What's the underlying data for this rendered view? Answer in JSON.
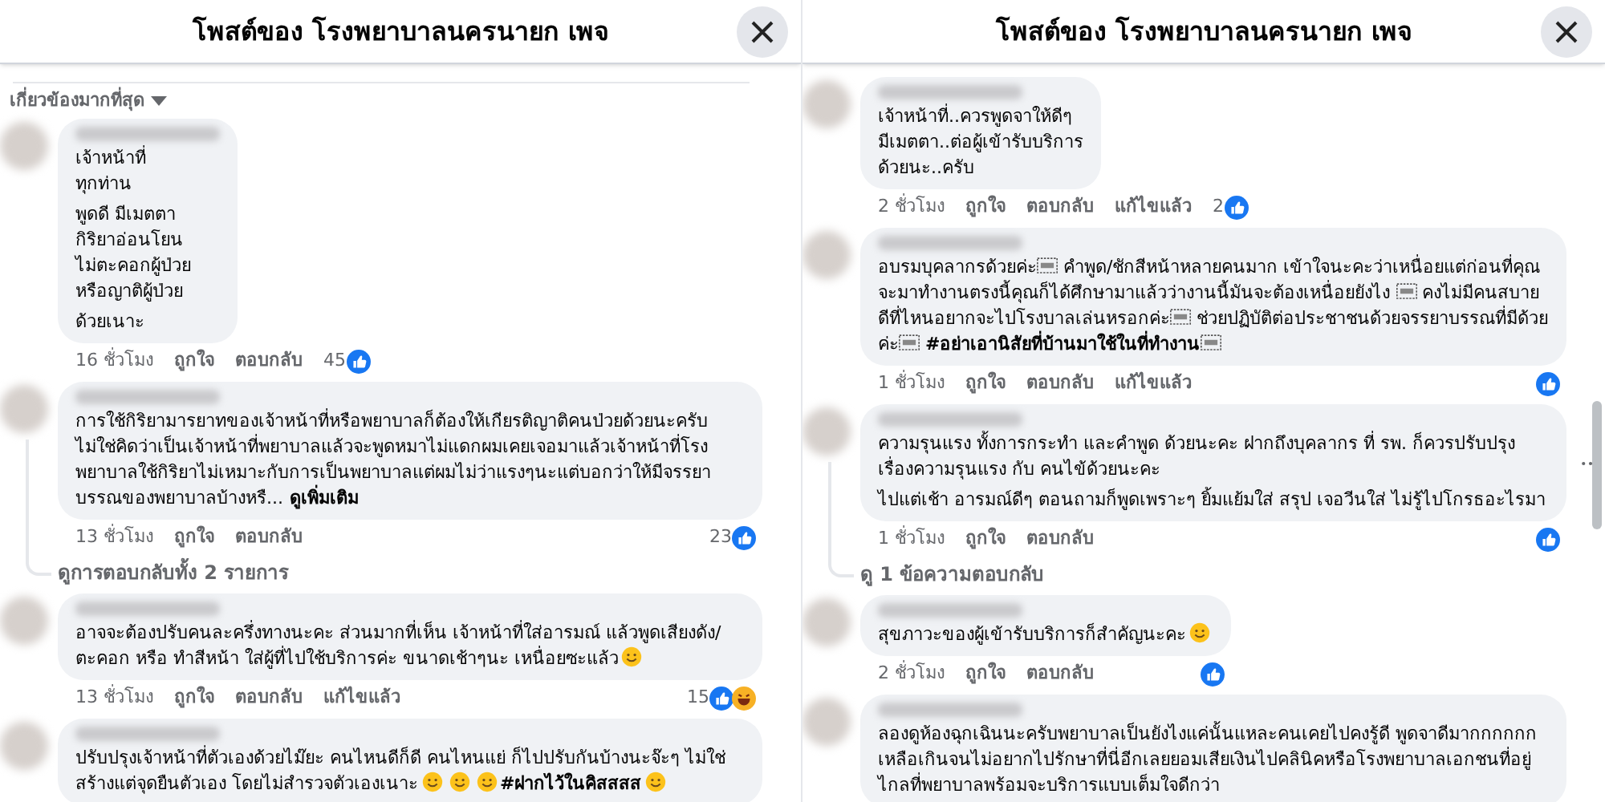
{
  "panels": [
    {
      "title": "โพสต์ของ โรงพยาบาลนครนายก เพจ",
      "sort_label": "เกี่ยวข้องมากที่สุด",
      "items": [
        {
          "kind": "comment",
          "paragraphs": [
            [
              {
                "kind": "text",
                "text": "เจ้าหน้าที่\nทุกท่าน"
              }
            ],
            [
              {
                "kind": "text",
                "text": "พูดดี มีเมตตา\nกิริยาอ่อนโยน\nไม่ตะคอกผู้ป่วย\nหรือญาติผู้ป่วย"
              }
            ],
            [
              {
                "kind": "text",
                "text": "ด้วยเนาะ"
              }
            ]
          ],
          "footer": {
            "time": "16 ชั่วโมง",
            "actions": [
              "ถูกใจ",
              "ตอบกลับ"
            ],
            "reactions": {
              "count": "45",
              "types": [
                {
                  "kind": "like"
                }
              ]
            }
          }
        },
        {
          "kind": "comment",
          "paragraphs": [
            [
              {
                "kind": "text",
                "text": "การใช้กิริยามารยาทของเจ้าหน้าที่หรือพยาบาลก็ต้องให้เกียรติญาติคนป่วยด้วยนะครับไม่ใช่คิดว่าเป็นเจ้าหน้าที่พยาบาลแล้วจะพูดหมาไม่แดกผมเคยเจอมาแล้วเจ้าหน้าที่โรงพยาบาลใช้กิริยาไม่เหมาะกับการเป็นพยาบาลแต่ผมไม่ว่าแรงๆนะแต่บอกว่าให้มีจรรยาบรรณของพยาบาลบ้างหรื..."
              },
              {
                "kind": "link",
                "text": "ดูเพิ่มเติม"
              }
            ]
          ],
          "footer": {
            "time": "13 ชั่วโมง",
            "actions": [
              "ถูกใจ",
              "ตอบกลับ"
            ],
            "reactions": {
              "count": "23",
              "types": [
                {
                  "kind": "like"
                }
              ]
            }
          }
        },
        {
          "kind": "replies",
          "text": "ดูการตอบกลับทั้ง 2 รายการ"
        },
        {
          "kind": "comment",
          "paragraphs": [
            [
              {
                "kind": "text",
                "text": "อาจจะต้องปรับคนละครึ่งทางนะคะ ส่วนมากที่เห็น เจ้าหน้าที่ใส่อารมณ์ แล้วพูดเสียงดัง/ตะคอก หรือ ทำสีหน้า ใส่ผู้ที่ไปใช้บริการค่ะ ขนาดเช้าๆนะ เหนื่อยซะแล้ว"
              },
              {
                "kind": "emoji"
              }
            ]
          ],
          "footer": {
            "time": "13 ชั่วโมง",
            "actions": [
              "ถูกใจ",
              "ตอบกลับ",
              "แก้ไขแล้ว"
            ],
            "reactions": {
              "count": "15",
              "types": [
                {
                  "kind": "like"
                },
                {
                  "kind": "haha"
                }
              ]
            }
          }
        },
        {
          "kind": "comment",
          "paragraphs": [
            [
              {
                "kind": "text",
                "text": "ปรับปรุงเจ้าหน้าที่ตัวเองด้วยไม๊ยะ คนไหนดีก็ดี คนไหนแย่ ก็ไปปรับกันบ้างนะจ๊ะๆ ไม่ใช่สร้างแต่จุดยืนตัวเอง โดยไม่สำรวจตัวเองเนาะ"
              },
              {
                "kind": "emoji"
              },
              {
                "kind": "emoji"
              },
              {
                "kind": "emoji"
              },
              {
                "kind": "text",
                "text": "**#ฝากไว้ในคิสสสส**"
              },
              {
                "kind": "emoji"
              }
            ]
          ]
        }
      ]
    },
    {
      "title": "โพสต์ของ โรงพยาบาลนครนายก เพจ",
      "items": [
        {
          "kind": "comment",
          "paragraphs": [
            [
              {
                "kind": "text",
                "text": "เจ้าหน้าที่..ควรพูดจาให้ดีๆ\nมีเมตตา..ต่อผู้เข้ารับบริการ\nด้วยนะ..ครับ"
              }
            ]
          ],
          "footer": {
            "time": "2 ชั่วโมง",
            "actions": [
              "ถูกใจ",
              "ตอบกลับ",
              "แก้ไขแล้ว"
            ],
            "reactions": {
              "count": "2",
              "types": [
                {
                  "kind": "like"
                }
              ]
            }
          }
        },
        {
          "kind": "comment",
          "paragraphs": [
            [
              {
                "kind": "text",
                "text": "อบรมบุคลากรด้วยค่ะ"
              },
              {
                "kind": "obj"
              },
              {
                "kind": "text",
                "text": " คำพูด/ชักสีหน้าหลายคนมาก เข้าใจนะคะว่าเหนื่อยแต่ก่อนที่คุณจะมาทำงานตรงนี้คุณก็ได้ศึกษามาแล้วว่างานนี้มันจะต้องเหนื่อยยังไง "
              },
              {
                "kind": "obj"
              },
              {
                "kind": "text",
                "text": " คงไม่มีคนสบายดีที่ไหนอยากจะไปโรงบาลเล่นหรอกค่ะ"
              },
              {
                "kind": "obj"
              },
              {
                "kind": "text",
                "text": " ช่วยปฏิบัติต่อประชาชนด้วยจรรยาบรรณที่มีด้วยค่ะ"
              },
              {
                "kind": "obj"
              },
              {
                "kind": "text",
                "text": " **#อย่าเอานิสัยที่บ้านมาใช้ในที่ทำงาน**"
              },
              {
                "kind": "obj"
              }
            ]
          ],
          "footer": {
            "time": "1 ชั่วโมง",
            "actions": [
              "ถูกใจ",
              "ตอบกลับ",
              "แก้ไขแล้ว"
            ],
            "reactions": {
              "types": [
                {
                  "kind": "like"
                }
              ]
            }
          }
        },
        {
          "kind": "comment",
          "more": true,
          "paragraphs": [
            [
              {
                "kind": "text",
                "text": "ความรุนแรง ทั้งการกระทำ และคำพูด ด้วยนะคะ ฝากถึงบุคลากร ที่ รพ. ก็ควรปรับปรุงเรื่องความรุนแรง กับ คนไข้ด้วยนะคะ"
              }
            ],
            [
              {
                "kind": "text",
                "text": "ไปแต่เช้า อารมณ์ดีๆ ตอนถามก็พูดเพราะๆ ยิ้มแย้มใส่ สรุป เจอวีนใส่ ไม่รู้ไปโกรธอะไรมา"
              }
            ]
          ],
          "footer": {
            "time": "1 ชั่วโมง",
            "actions": [
              "ถูกใจ",
              "ตอบกลับ"
            ],
            "reactions": {
              "types": [
                {
                  "kind": "like"
                }
              ]
            }
          }
        },
        {
          "kind": "replies",
          "text": "ดู 1 ข้อความตอบกลับ"
        },
        {
          "kind": "comment",
          "paragraphs": [
            [
              {
                "kind": "text",
                "text": "สุขภาวะของผู้เข้ารับบริการก็สำคัญนะคะ"
              },
              {
                "kind": "emoji"
              }
            ]
          ],
          "footer": {
            "time": "2 ชั่วโมง",
            "actions": [
              "ถูกใจ",
              "ตอบกลับ"
            ],
            "reactions": {
              "types": [
                {
                  "kind": "like"
                }
              ]
            }
          }
        },
        {
          "kind": "comment",
          "paragraphs": [
            [
              {
                "kind": "text",
                "text": "ลองดูห้องฉุกเฉินนะครับพยาบาลเป็นยังไงแค่นั้นแหละคนเคยไปคงรู้ดี พูดจาดีมากกกกกกเหลือเกินจนไม่อยากไปรักษาที่นี่อีกเลยยอมเสียเงินไปคลินิคหรือโรงพยาบาลเอกชนที่อยู่ไกลที่พยาบาลพร้อมจะบริการแบบเต็มใจดีกว่า"
              }
            ]
          ]
        }
      ]
    }
  ]
}
